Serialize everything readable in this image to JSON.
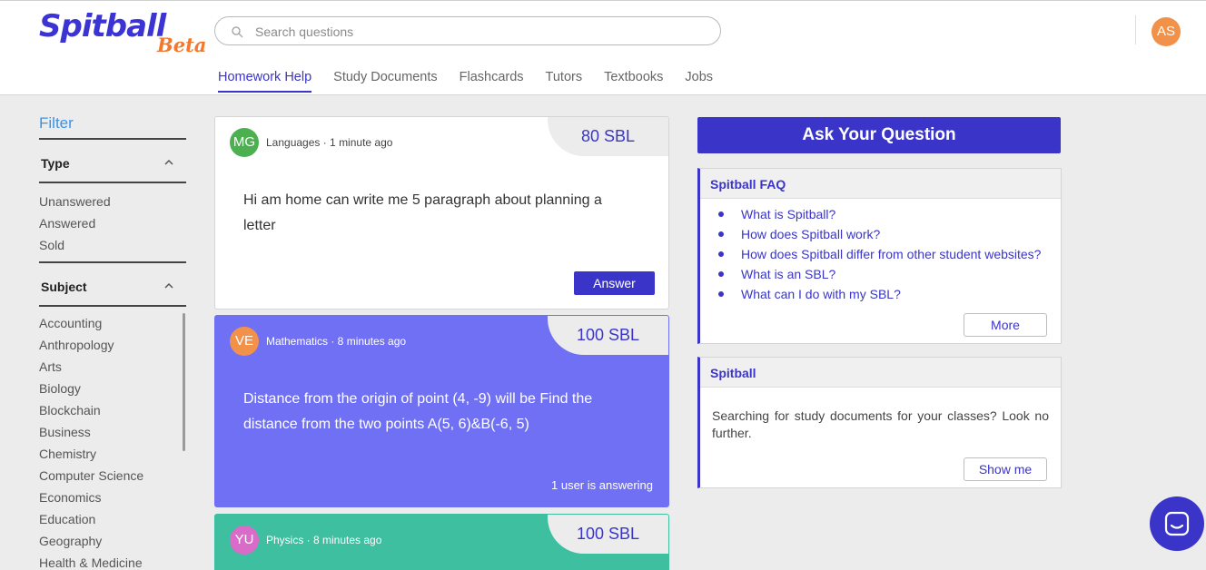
{
  "header": {
    "logo_main": "Spitball",
    "logo_beta": "Beta",
    "search_placeholder": "Search questions",
    "user_initials": "AS",
    "nav": [
      {
        "label": "Homework Help",
        "active": true
      },
      {
        "label": "Study Documents"
      },
      {
        "label": "Flashcards"
      },
      {
        "label": "Tutors"
      },
      {
        "label": "Textbooks"
      },
      {
        "label": "Jobs"
      }
    ]
  },
  "sidebar": {
    "filter_title": "Filter",
    "type_label": "Type",
    "type_options": [
      "Unanswered",
      "Answered",
      "Sold"
    ],
    "subject_label": "Subject",
    "subjects": [
      "Accounting",
      "Anthropology",
      "Arts",
      "Biology",
      "Blockchain",
      "Business",
      "Chemistry",
      "Computer Science",
      "Economics",
      "Education",
      "Geography",
      "Health & Medicine"
    ]
  },
  "questions": [
    {
      "initials": "MG",
      "avatar_color": "#4caf50",
      "meta": "Languages · 1 minute ago",
      "reward": "80 SBL",
      "text": "Hi am home can write me 5 paragraph about planning a letter",
      "action_label": "Answer"
    },
    {
      "initials": "VE",
      "avatar_color": "#f2914a",
      "meta": "Mathematics · 8 minutes ago",
      "reward": "100 SBL",
      "text": "Distance from the origin of point (4, -9) will be Find the distance from the two points A(5, 6)&B(-6, 5)",
      "status": "1 user is answering"
    },
    {
      "initials": "YU",
      "avatar_color": "#d86cc8",
      "meta": "Physics · 8 minutes ago",
      "reward": "100 SBL"
    }
  ],
  "ask": {
    "label": "Ask Your Question"
  },
  "faq": {
    "title": "Spitball FAQ",
    "items": [
      "What is Spitball?",
      "How does Spitball work?",
      "How does Spitball differ from other student websites?",
      "What is an SBL?",
      "What can I do with my SBL?"
    ],
    "more_label": "More"
  },
  "promo": {
    "title": "Spitball",
    "text": "Searching for study documents for your classes? Look no further.",
    "button_label": "Show me"
  },
  "colors": {
    "brand": "#3a35c8",
    "accent": "#f2782d",
    "filter": "#3a93e5",
    "card_purple": "#7070f5",
    "card_teal": "#3dbfa0"
  }
}
